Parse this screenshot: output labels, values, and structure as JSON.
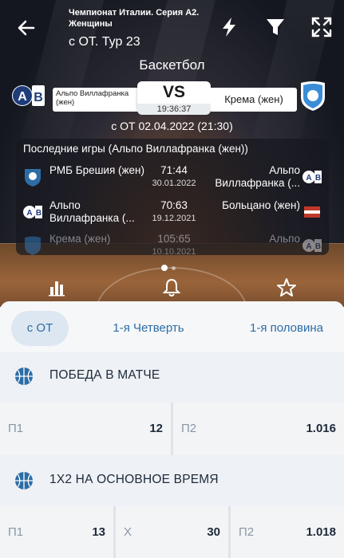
{
  "header": {
    "title": "Чемпионат Италии. Серия А2. Женщины",
    "subtitle": "с ОТ. Тур 23"
  },
  "sport": "Баскетбол",
  "match": {
    "home": "Альпо Виллафранка (жен)",
    "away": "Крема (жен)",
    "vs": "VS",
    "time": "19:36:37",
    "date": "с ОТ 02.04.2022 (21:30)"
  },
  "last_games": {
    "title": "Последние игры (Альпо Виллафранка (жен))",
    "rows": [
      {
        "home": "РМБ Брешия (жен)",
        "score": "71:44",
        "date": "30.01.2022",
        "away": "Альпо Виллафранка (..."
      },
      {
        "home": "Альпо Виллафранка (...",
        "score": "70:63",
        "date": "19.12.2021",
        "away": "Больцано (жен)"
      },
      {
        "home": "Крема (жен)",
        "score": "105:65",
        "date": "10.10.2021",
        "away": "Альпо"
      }
    ]
  },
  "tabs": [
    "с ОТ",
    "1-я Четверть",
    "1-я половина"
  ],
  "markets": [
    {
      "title": "ПОБЕДА В МАТЧЕ",
      "odds": [
        {
          "label": "П1",
          "value": "12"
        },
        {
          "label": "П2",
          "value": "1.016"
        }
      ]
    },
    {
      "title": "1X2 НА ОСНОВНОЕ ВРЕМЯ",
      "odds": [
        {
          "label": "П1",
          "value": "13"
        },
        {
          "label": "X",
          "value": "30"
        },
        {
          "label": "П2",
          "value": "1.018"
        }
      ]
    }
  ],
  "icons": [
    "back-arrow-icon",
    "lightning-icon",
    "filter-icon",
    "expand-icon",
    "stats-icon",
    "bell-icon",
    "star-icon",
    "basketball-icon"
  ],
  "colors": {
    "accent": "#2d6da6",
    "text_dark": "#1d2a3a",
    "label_grey": "#8a96a6"
  }
}
